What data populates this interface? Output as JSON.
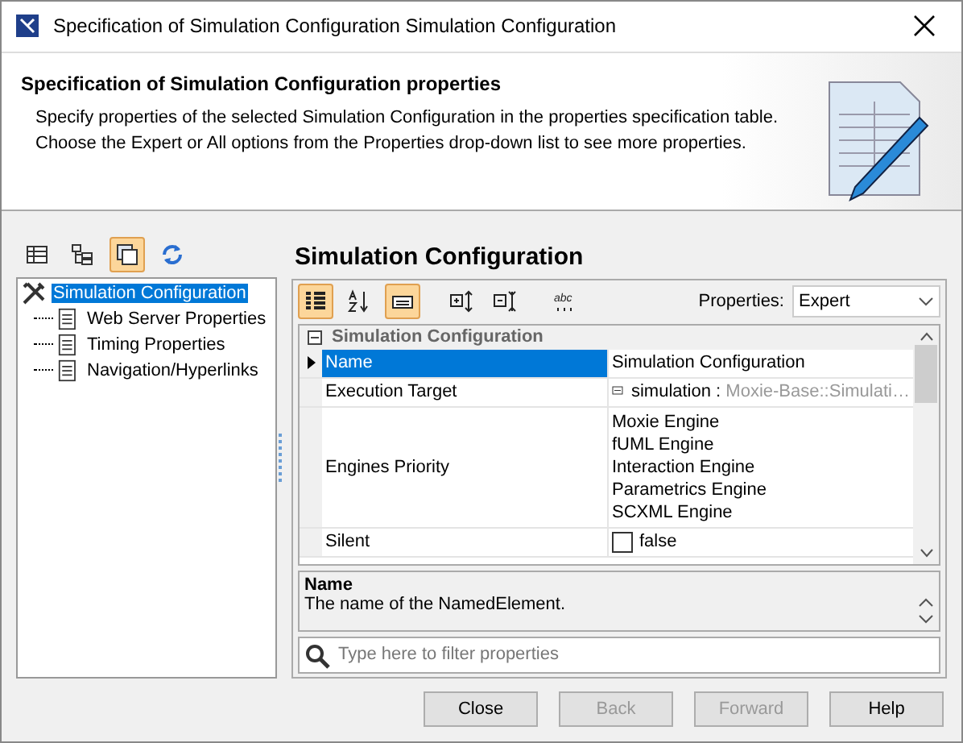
{
  "window": {
    "title": "Specification of Simulation Configuration Simulation Configuration"
  },
  "header": {
    "title": "Specification of Simulation Configuration properties",
    "lines": [
      "Specify properties of the selected Simulation Configuration in the properties specification table.",
      "Choose the Expert or All options from the Properties drop-down list to see more properties."
    ]
  },
  "left_toolbar": [
    {
      "kind": "table",
      "selected": false
    },
    {
      "kind": "tree",
      "selected": false
    },
    {
      "kind": "copy",
      "selected": true
    },
    {
      "kind": "refresh",
      "selected": false
    }
  ],
  "tree": [
    {
      "label": "Simulation Configuration",
      "selected": true,
      "children": [
        {
          "label": "Web Server Properties",
          "selected": false
        },
        {
          "label": "Timing Properties",
          "selected": false
        },
        {
          "label": "Navigation/Hyperlinks",
          "selected": false
        }
      ]
    }
  ],
  "panel_title": "Simulation Configuration",
  "properties_toolbar": {
    "buttons": [
      {
        "kind": "categorized",
        "selected": true
      },
      {
        "kind": "sort",
        "selected": false
      },
      {
        "kind": "description",
        "selected": true
      },
      {
        "kind": "expand",
        "selected": false
      },
      {
        "kind": "collapse",
        "selected": false
      },
      {
        "kind": "abc",
        "selected": false
      }
    ],
    "label": "Properties:",
    "value": "Expert"
  },
  "table": {
    "group": "Simulation Configuration",
    "expanded": true,
    "rows": [
      {
        "kind": "text",
        "name": "Name",
        "value": "Simulation Configuration",
        "selected": true
      },
      {
        "kind": "reference",
        "name": "Execution Target",
        "value": "simulation : ",
        "type": "Moxie-Base::Simulati…",
        "selected": false
      },
      {
        "kind": "list",
        "name": "Engines Priority",
        "values": [
          "Moxie Engine",
          "fUML Engine",
          "Interaction Engine",
          "Parametrics Engine",
          "SCXML Engine"
        ],
        "selected": false
      },
      {
        "kind": "checkbox",
        "name": "Silent",
        "value": "false",
        "checked": false,
        "selected": false
      }
    ]
  },
  "description": {
    "title": "Name",
    "text": "The name of the NamedElement."
  },
  "filter": {
    "placeholder": "Type here to filter properties"
  },
  "buttons": [
    {
      "label": "Close",
      "disabled": false
    },
    {
      "label": "Back",
      "disabled": true
    },
    {
      "label": "Forward",
      "disabled": true
    },
    {
      "label": "Help",
      "disabled": false
    }
  ]
}
